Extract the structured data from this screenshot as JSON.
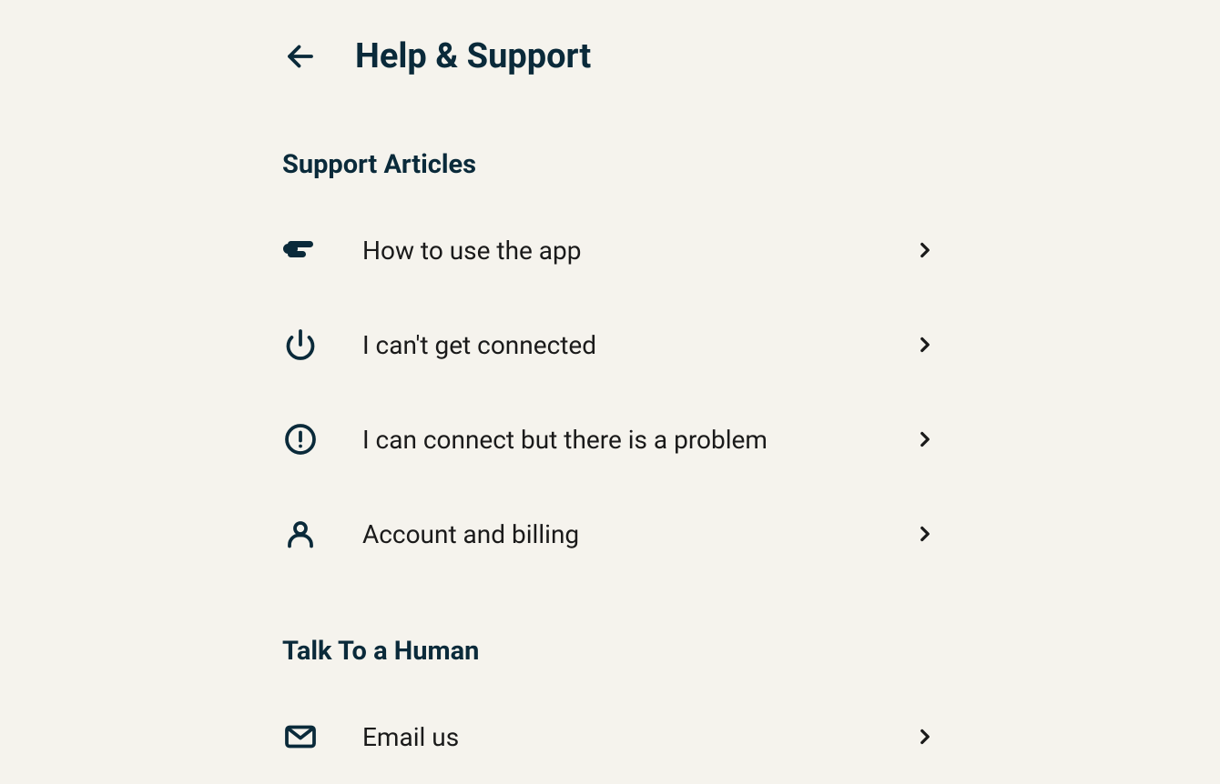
{
  "header": {
    "title": "Help & Support"
  },
  "sections": {
    "support_articles": {
      "title": "Support Articles",
      "items": [
        {
          "label": "How to use the app"
        },
        {
          "label": "I can't get connected"
        },
        {
          "label": "I can connect but there is a problem"
        },
        {
          "label": "Account and billing"
        }
      ]
    },
    "talk_to_human": {
      "title": "Talk To a Human",
      "items": [
        {
          "label": "Email us"
        }
      ]
    }
  },
  "colors": {
    "background": "#f5f3ed",
    "text_primary": "#0a2a3a",
    "text_body": "#1a1a1a"
  }
}
